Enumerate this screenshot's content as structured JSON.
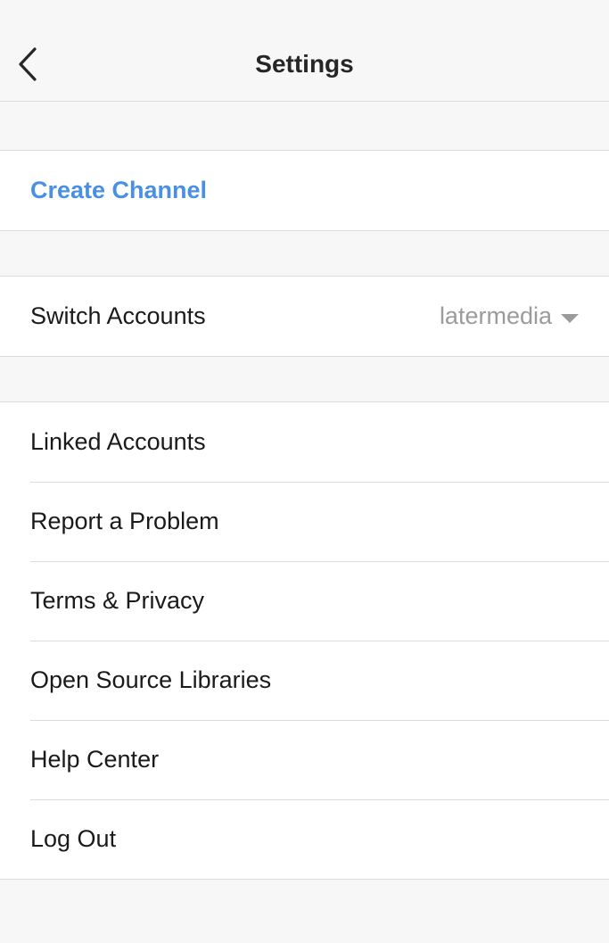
{
  "header": {
    "title": "Settings",
    "back_icon": "chevron-left-icon"
  },
  "sections": {
    "create_channel": {
      "label": "Create Channel"
    },
    "switch_accounts": {
      "label": "Switch Accounts",
      "value": "latermedia",
      "value_icon": "caret-down-icon"
    },
    "menu": [
      {
        "label": "Linked Accounts"
      },
      {
        "label": "Report a Problem"
      },
      {
        "label": "Terms & Privacy"
      },
      {
        "label": "Open Source Libraries"
      },
      {
        "label": "Help Center"
      },
      {
        "label": "Log Out"
      }
    ]
  },
  "colors": {
    "accent": "#4a90e2",
    "muted": "#9b9b9b",
    "background": "#f7f7f7",
    "row_background": "#ffffff",
    "divider": "#dcdcdc"
  }
}
